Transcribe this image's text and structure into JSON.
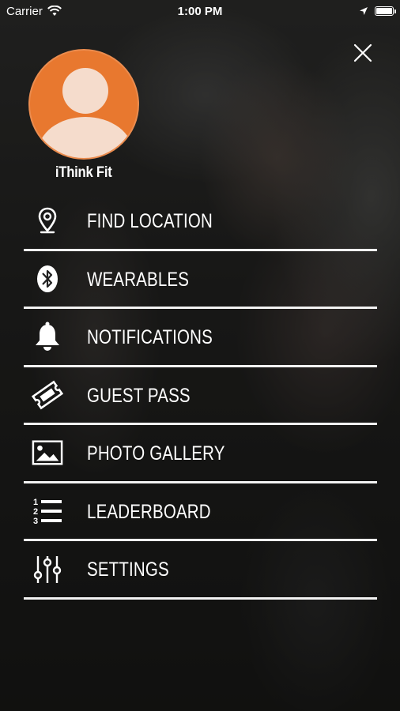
{
  "status_bar": {
    "carrier": "Carrier",
    "time": "1:00 PM",
    "battery_level": 1.0
  },
  "profile": {
    "name": "iThink Fit",
    "avatar_color": "#e8782f"
  },
  "menu": {
    "items": [
      {
        "label": "FIND LOCATION",
        "icon": "location-pin-icon"
      },
      {
        "label": "WEARABLES",
        "icon": "bluetooth-icon"
      },
      {
        "label": "NOTIFICATIONS",
        "icon": "bell-icon"
      },
      {
        "label": "GUEST PASS",
        "icon": "ticket-icon"
      },
      {
        "label": "PHOTO GALLERY",
        "icon": "image-icon"
      },
      {
        "label": "LEADERBOARD",
        "icon": "ranked-list-icon"
      },
      {
        "label": "SETTINGS",
        "icon": "sliders-icon"
      }
    ]
  }
}
